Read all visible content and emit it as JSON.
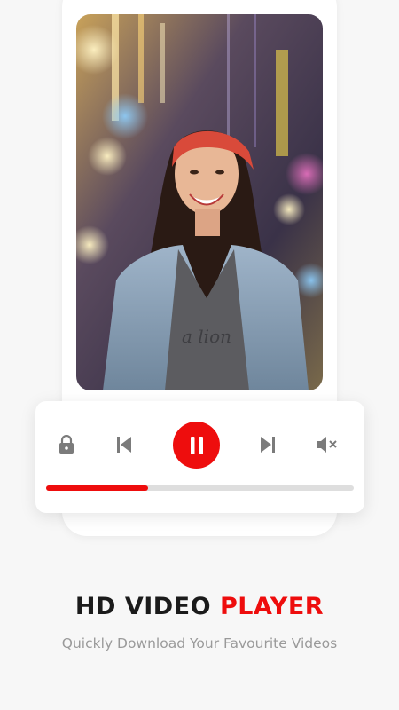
{
  "hero": {
    "image_description": "video-preview-photo"
  },
  "controls": {
    "lock_icon": "lock-icon",
    "prev_icon": "skip-previous-icon",
    "pause_icon": "pause-icon",
    "next_icon": "skip-next-icon",
    "mute_icon": "volume-mute-icon",
    "accent_color": "#ee0d0d",
    "progress_fraction": 0.33
  },
  "headline": {
    "part1": "HD VIDEO ",
    "part2": "PLAYER"
  },
  "subtitle": "Quickly Download Your Favourite Videos"
}
